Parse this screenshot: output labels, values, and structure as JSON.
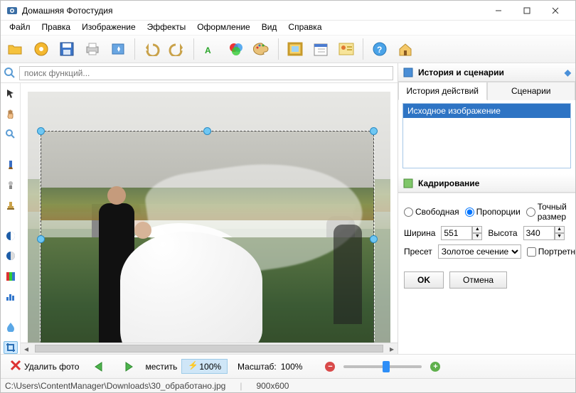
{
  "titlebar": {
    "app_title": "Домашняя Фотостудия"
  },
  "menu": [
    "Файл",
    "Правка",
    "Изображение",
    "Эффекты",
    "Оформление",
    "Вид",
    "Справка"
  ],
  "search": {
    "placeholder": "поиск функций..."
  },
  "right": {
    "history_scenarios_title": "История и сценарии",
    "tabs": {
      "history": "История действий",
      "scenarios": "Сценарии"
    },
    "history_item": "Исходное изображение",
    "crop_title": "Кадрирование",
    "mode": {
      "free": "Свободная",
      "prop": "Пропорции",
      "exact": "Точный размер"
    },
    "width_label": "Ширина",
    "width_value": "551",
    "height_label": "Высота",
    "height_value": "340",
    "preset_label": "Пресет",
    "preset_value": "Золотое сечение",
    "portrait_label": "Портретные",
    "ok": "OK",
    "cancel": "Отмена"
  },
  "bottom": {
    "delete_photo": "Удалить фото",
    "fit_label": "местить",
    "zoom_badge": "100%",
    "scale_label": "Масштаб:",
    "scale_value": "100%"
  },
  "status": {
    "path": "C:\\Users\\ContentManager\\Downloads\\30_обработано.jpg",
    "dims": "900x600"
  }
}
